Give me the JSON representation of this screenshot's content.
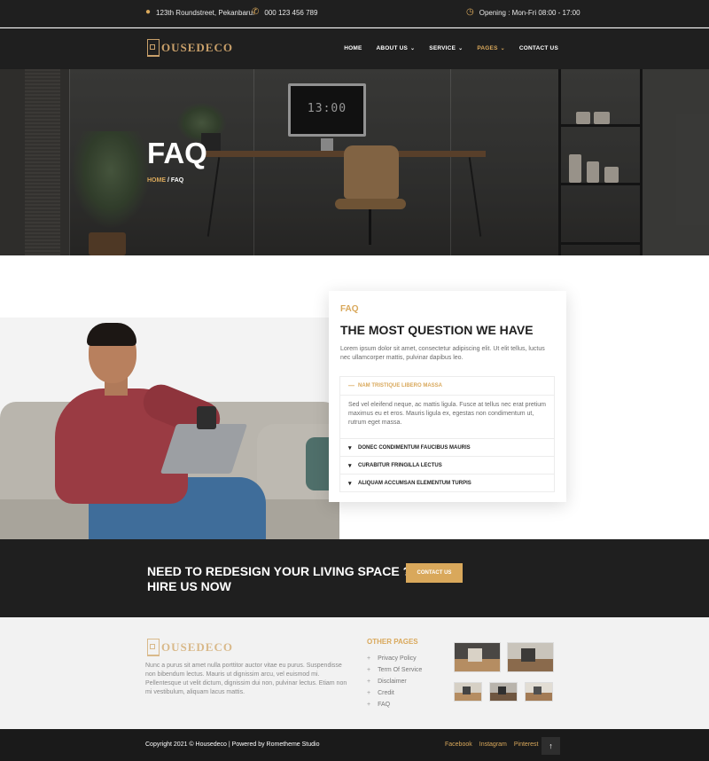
{
  "topbar": {
    "address": "123th Roundstreet, Pekanbaru.",
    "phone": "000 123 456 789",
    "hours": "Opening : Mon-Fri 08:00 - 17:00",
    "address_icon": "map-pin-icon",
    "phone_icon": "phone-icon",
    "hours_icon": "clock-icon"
  },
  "brand": {
    "name": "OUSEDECO",
    "accent": "#d9a85b"
  },
  "nav": {
    "home": "HOME",
    "about": "ABOUT US",
    "service": "SERVICE",
    "pages": "PAGES",
    "contact": "CONTACT US"
  },
  "hero": {
    "title": "FAQ",
    "crumb_home": "HOME",
    "crumb_sep": " / ",
    "crumb_current": "FAQ",
    "monitor_text": "13:00"
  },
  "faq": {
    "kicker": "FAQ",
    "heading": "THE MOST QUESTION WE HAVE",
    "intro": "Lorem ipsum dolor sit amet, consectetur adipiscing elit. Ut elit tellus, luctus nec ullamcorper mattis, pulvinar dapibus leo.",
    "items": [
      {
        "title": "NAM TRISTIQUE LIBERO MASSA",
        "open": true,
        "body": "Sed vel eleifend neque, ac mattis ligula. Fusce at tellus nec erat pretium maximus eu et eros. Mauris ligula ex, egestas non condimentum ut, rutrum eget massa."
      },
      {
        "title": "DONEC CONDIMENTUM FAUCIBUS MAURIS",
        "open": false
      },
      {
        "title": "CURABITUR FRINGILLA LECTUS",
        "open": false
      },
      {
        "title": "ALIQUAM ACCUMSAN ELEMENTUM TURPIS",
        "open": false
      }
    ]
  },
  "cta": {
    "line1": "NEED TO REDESIGN YOUR LIVING SPACE ?",
    "line2": "HIRE US NOW",
    "button": "CONTACT US"
  },
  "footer": {
    "description": "Nunc a purus sit amet nulla porttitor auctor vitae eu purus. Suspendisse non bibendum lectus. Mauris ut dignissim arcu, vel euismod mi. Pellentesque ut velit dictum, dignissim dui non, pulvinar lectus. Etiam non mi vestibulum, aliquam lacus mattis.",
    "links_title": "OTHER PAGES",
    "links": [
      "Privacy Policy",
      "Term Of Service",
      "Disclaimer",
      "Credit",
      "FAQ"
    ]
  },
  "bottom": {
    "copyright": "Copyright 2021 © Housedeco | Powered by Rometheme Studio",
    "social": [
      "Facebook",
      "Instagram",
      "Pinterest"
    ],
    "to_top_icon": "arrow-up-icon"
  }
}
